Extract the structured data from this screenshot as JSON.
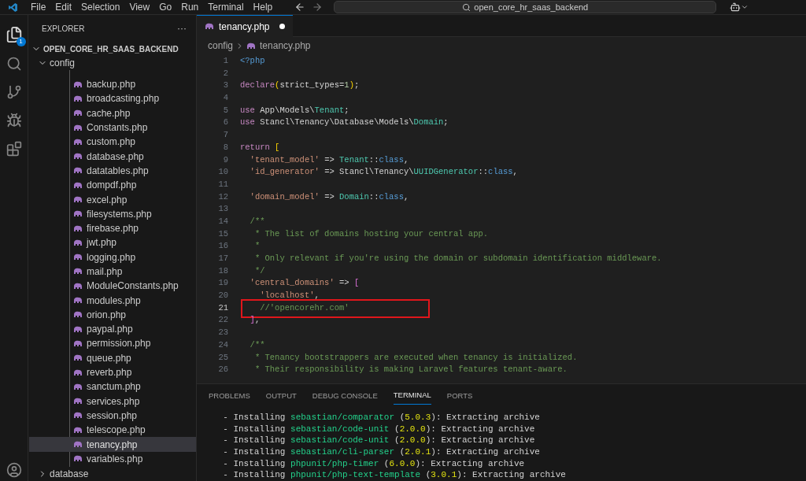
{
  "menu": [
    "File",
    "Edit",
    "Selection",
    "View",
    "Go",
    "Run",
    "Terminal",
    "Help"
  ],
  "command_center": {
    "text": "open_core_hr_saas_backend"
  },
  "activity_bar": {
    "explorer_badge": "1"
  },
  "sidebar": {
    "title": "EXPLORER",
    "more": "···",
    "root": {
      "label": "OPEN_CORE_HR_SAAS_BACKEND",
      "expanded": true
    },
    "folders": [
      {
        "label": "config",
        "expanded": true,
        "children": [
          {
            "label": "backup.php",
            "selected": false
          },
          {
            "label": "broadcasting.php",
            "selected": false
          },
          {
            "label": "cache.php",
            "selected": false
          },
          {
            "label": "Constants.php",
            "selected": false
          },
          {
            "label": "custom.php",
            "selected": false
          },
          {
            "label": "database.php",
            "selected": false
          },
          {
            "label": "datatables.php",
            "selected": false
          },
          {
            "label": "dompdf.php",
            "selected": false
          },
          {
            "label": "excel.php",
            "selected": false
          },
          {
            "label": "filesystems.php",
            "selected": false
          },
          {
            "label": "firebase.php",
            "selected": false
          },
          {
            "label": "jwt.php",
            "selected": false
          },
          {
            "label": "logging.php",
            "selected": false
          },
          {
            "label": "mail.php",
            "selected": false
          },
          {
            "label": "ModuleConstants.php",
            "selected": false
          },
          {
            "label": "modules.php",
            "selected": false
          },
          {
            "label": "orion.php",
            "selected": false
          },
          {
            "label": "paypal.php",
            "selected": false
          },
          {
            "label": "permission.php",
            "selected": false
          },
          {
            "label": "queue.php",
            "selected": false
          },
          {
            "label": "reverb.php",
            "selected": false
          },
          {
            "label": "sanctum.php",
            "selected": false
          },
          {
            "label": "services.php",
            "selected": false
          },
          {
            "label": "session.php",
            "selected": false
          },
          {
            "label": "telescope.php",
            "selected": false
          },
          {
            "label": "tenancy.php",
            "selected": true
          },
          {
            "label": "variables.php",
            "selected": false
          }
        ]
      },
      {
        "label": "database",
        "expanded": false
      }
    ]
  },
  "tab": {
    "label": "tenancy.php",
    "modified": true,
    "selected": true
  },
  "breadcrumb": [
    "config",
    "tenancy.php"
  ],
  "editor": {
    "lines": [
      {
        "n": "1",
        "highlighted": false,
        "tokens": [
          {
            "kind": "blue",
            "t": "<?php"
          }
        ]
      },
      {
        "n": "2",
        "highlighted": false
      },
      {
        "n": "3",
        "highlighted": false,
        "tokens": [
          {
            "kind": "kw",
            "t": "declare"
          },
          {
            "kind": "br",
            "t": "("
          },
          {
            "kind": "plain",
            "t": "strict_types="
          },
          {
            "kind": "num",
            "t": "1"
          },
          {
            "kind": "br",
            "t": ")"
          },
          {
            "kind": "plain",
            "t": ";"
          }
        ]
      },
      {
        "n": "4",
        "highlighted": false
      },
      {
        "n": "5",
        "highlighted": false,
        "tokens": [
          {
            "kind": "kw",
            "t": "use"
          },
          {
            "kind": "plain",
            "t": " App\\Models\\"
          },
          {
            "kind": "type",
            "t": "Tenant"
          },
          {
            "kind": "plain",
            "t": ";"
          }
        ]
      },
      {
        "n": "6",
        "highlighted": false,
        "tokens": [
          {
            "kind": "kw",
            "t": "use"
          },
          {
            "kind": "plain",
            "t": " Stancl\\Tenancy\\Database\\Models\\"
          },
          {
            "kind": "type",
            "t": "Domain"
          },
          {
            "kind": "plain",
            "t": ";"
          }
        ]
      },
      {
        "n": "7",
        "highlighted": false
      },
      {
        "n": "8",
        "highlighted": false,
        "tokens": [
          {
            "kind": "kw",
            "t": "return"
          },
          {
            "kind": "br",
            "t": " ["
          }
        ]
      },
      {
        "n": "9",
        "highlighted": false,
        "tokens": [
          {
            "kind": "str",
            "t": "  'tenant_model'"
          },
          {
            "kind": "plain",
            "t": " => "
          },
          {
            "kind": "type",
            "t": "Tenant"
          },
          {
            "kind": "plain",
            "t": "::"
          },
          {
            "kind": "blue",
            "t": "class"
          },
          {
            "kind": "plain",
            "t": ","
          }
        ]
      },
      {
        "n": "10",
        "highlighted": false,
        "tokens": [
          {
            "kind": "str",
            "t": "  'id_generator'"
          },
          {
            "kind": "plain",
            "t": " => Stancl\\Tenancy\\"
          },
          {
            "kind": "type",
            "t": "UUIDGenerator"
          },
          {
            "kind": "plain",
            "t": "::"
          },
          {
            "kind": "blue",
            "t": "class"
          },
          {
            "kind": "plain",
            "t": ","
          }
        ]
      },
      {
        "n": "11",
        "highlighted": false
      },
      {
        "n": "12",
        "highlighted": false,
        "tokens": [
          {
            "kind": "str",
            "t": "  'domain_model'"
          },
          {
            "kind": "plain",
            "t": " => "
          },
          {
            "kind": "type",
            "t": "Domain"
          },
          {
            "kind": "plain",
            "t": "::"
          },
          {
            "kind": "blue",
            "t": "class"
          },
          {
            "kind": "plain",
            "t": ","
          }
        ]
      },
      {
        "n": "13",
        "highlighted": false
      },
      {
        "n": "14",
        "highlighted": false,
        "tokens": [
          {
            "kind": "comment",
            "t": "  /**"
          }
        ]
      },
      {
        "n": "15",
        "highlighted": false,
        "tokens": [
          {
            "kind": "comment",
            "t": "   * The list of domains hosting your central app."
          }
        ]
      },
      {
        "n": "16",
        "highlighted": false,
        "tokens": [
          {
            "kind": "comment",
            "t": "   *"
          }
        ]
      },
      {
        "n": "17",
        "highlighted": false,
        "tokens": [
          {
            "kind": "comment",
            "t": "   * Only relevant if you're using the domain or subdomain identification middleware."
          }
        ]
      },
      {
        "n": "18",
        "highlighted": false,
        "tokens": [
          {
            "kind": "comment",
            "t": "   */"
          }
        ]
      },
      {
        "n": "19",
        "highlighted": false,
        "tokens": [
          {
            "kind": "str",
            "t": "  'central_domains'"
          },
          {
            "kind": "plain",
            "t": " => "
          },
          {
            "kind": "br2",
            "t": "["
          }
        ]
      },
      {
        "n": "20",
        "highlighted": false,
        "tokens": [
          {
            "kind": "str",
            "t": "    'localhost'"
          },
          {
            "kind": "plain",
            "t": ","
          }
        ]
      },
      {
        "n": "21",
        "highlighted": true,
        "tokens": [
          {
            "kind": "comment",
            "t": "    //'opencorehr.com'"
          }
        ]
      },
      {
        "n": "22",
        "highlighted": false,
        "tokens": [
          {
            "kind": "br2",
            "t": "  ]"
          },
          {
            "kind": "plain",
            "t": ","
          }
        ]
      },
      {
        "n": "23",
        "highlighted": false
      },
      {
        "n": "24",
        "highlighted": false,
        "tokens": [
          {
            "kind": "comment",
            "t": "  /**"
          }
        ]
      },
      {
        "n": "25",
        "highlighted": false,
        "tokens": [
          {
            "kind": "comment",
            "t": "   * Tenancy bootstrappers are executed when tenancy is initialized."
          }
        ]
      },
      {
        "n": "26",
        "highlighted": false,
        "tokens": [
          {
            "kind": "comment",
            "t": "   * Their responsibility is making Laravel features tenant-aware."
          }
        ]
      }
    ]
  },
  "panel": {
    "tabs": [
      {
        "label": "PROBLEMS",
        "selected": false
      },
      {
        "label": "OUTPUT",
        "selected": false
      },
      {
        "label": "DEBUG CONSOLE",
        "selected": false
      },
      {
        "label": "TERMINAL",
        "selected": true
      },
      {
        "label": "PORTS",
        "selected": false
      }
    ],
    "terminal_lines": [
      [
        {
          "kind": "plain",
          "t": "  - Installing "
        },
        {
          "kind": "pkg",
          "t": "sebastian/comparator"
        },
        {
          "kind": "plain",
          "t": " ("
        },
        {
          "kind": "ver",
          "t": "5.0.3"
        },
        {
          "kind": "plain",
          "t": "): Extracting archive"
        }
      ],
      [
        {
          "kind": "plain",
          "t": "  - Installing "
        },
        {
          "kind": "pkg",
          "t": "sebastian/code-unit"
        },
        {
          "kind": "plain",
          "t": " ("
        },
        {
          "kind": "ver",
          "t": "2.0.0"
        },
        {
          "kind": "plain",
          "t": "): Extracting archive"
        }
      ],
      [
        {
          "kind": "plain",
          "t": "  - Installing "
        },
        {
          "kind": "pkg",
          "t": "sebastian/code-unit"
        },
        {
          "kind": "plain",
          "t": " ("
        },
        {
          "kind": "ver",
          "t": "2.0.0"
        },
        {
          "kind": "plain",
          "t": "): Extracting archive"
        }
      ],
      [
        {
          "kind": "plain",
          "t": "  - Installing "
        },
        {
          "kind": "pkg",
          "t": "sebastian/cli-parser"
        },
        {
          "kind": "plain",
          "t": " ("
        },
        {
          "kind": "ver",
          "t": "2.0.1"
        },
        {
          "kind": "plain",
          "t": "): Extracting archive"
        }
      ],
      [
        {
          "kind": "plain",
          "t": "  - Installing "
        },
        {
          "kind": "pkg",
          "t": "phpunit/php-timer"
        },
        {
          "kind": "plain",
          "t": " ("
        },
        {
          "kind": "ver",
          "t": "6.0.0"
        },
        {
          "kind": "plain",
          "t": "): Extracting archive"
        }
      ],
      [
        {
          "kind": "plain",
          "t": "  - Installing "
        },
        {
          "kind": "pkg",
          "t": "phpunit/php-text-template"
        },
        {
          "kind": "plain",
          "t": " ("
        },
        {
          "kind": "ver",
          "t": "3.0.1"
        },
        {
          "kind": "plain",
          "t": "): Extracting archive"
        }
      ]
    ]
  }
}
